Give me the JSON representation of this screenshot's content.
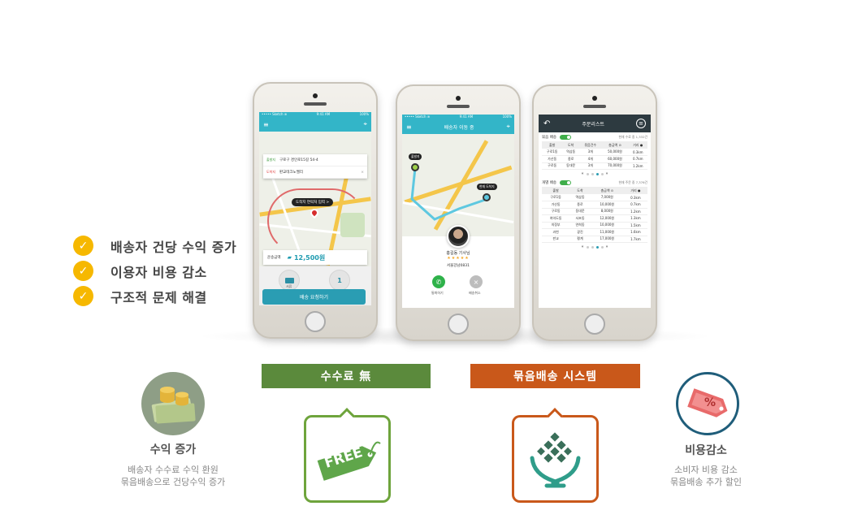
{
  "checklist": [
    "배송자 건당 수익 증가",
    "이용자 비용 감소",
    "구조적 문제 해결"
  ],
  "phone1": {
    "carrier": "••••• Sketch ≋",
    "time": "9:41 AM",
    "battery": "100%",
    "pickup_tag": "출발지",
    "pickup_address": "구로구 경인로15길 54-4",
    "dest_tag": "도착지",
    "dest_address": "판교테크노밸리",
    "bubble": "도착지 연락처 입력 >",
    "fee_label": "운송금액",
    "fee_value": "12,500원",
    "btn1_caption": "서류",
    "btn1_label": "물품종류",
    "btn2_value": "1",
    "btn2_label": "물품갯수",
    "request_button": "배송 요청하기"
  },
  "phone2": {
    "carrier": "••••• Sketch ≋",
    "time": "9:41 AM",
    "battery": "100%",
    "title": "배송자 이동 중",
    "pin_start": "출발지",
    "pin_end": "현재 도착지",
    "driver_name": "홍길동 기사님",
    "driver_stars": "★★★★★",
    "driver_plate": "서울강남0831",
    "call_label": "통화하기",
    "cancel_label": "배송취소"
  },
  "phone3": {
    "title": "주문리스트",
    "bundle_section": "묶음 배송",
    "bundle_note": "현재 수료 중 1,332건",
    "bundle_headers": [
      "출발",
      "도착",
      "묶음건수",
      "총금액 ⊙",
      "거리 ●"
    ],
    "bundle_rows": [
      [
        "구로1동",
        "역삼동",
        "3개",
        "50,000원",
        "0.3km"
      ],
      [
        "가산동",
        "종로",
        "4개",
        "60,000원",
        "0.7km"
      ],
      [
        "구로동",
        "동대문",
        "3개",
        "70,000원",
        "1.2km"
      ]
    ],
    "single_section": "개별 배송",
    "single_note": "현재 주문 중 7,376건",
    "single_headers": [
      "출발",
      "도착",
      "총금액 ⊙",
      "거리 ●"
    ],
    "single_rows": [
      [
        "구로1동",
        "역삼동",
        "7,000원",
        "0.3km"
      ],
      [
        "가산동",
        "종로",
        "10,000원",
        "0.7km"
      ],
      [
        "구로동",
        "동대문",
        "8,000원",
        "1.2km"
      ],
      [
        "여의도동",
        "서초동",
        "12,000원",
        "1.3km"
      ],
      [
        "의정부",
        "연희동",
        "10,000원",
        "1.5km"
      ],
      [
        "과천",
        "광진",
        "11,000원",
        "1.6km"
      ],
      [
        "판교",
        "평계",
        "17,000원",
        "1.7km"
      ]
    ],
    "pager_left": "«",
    "pager_right": "»"
  },
  "features": {
    "income": {
      "title": "수익 증가",
      "desc1": "배송자 수수료 수익 환원",
      "desc2": "묶음배송으로 건당수익 증가"
    },
    "free": {
      "bar": "수수료 無",
      "badge": "FREE"
    },
    "bundle": {
      "bar": "묶음배송 시스템"
    },
    "saving": {
      "title": "비용감소",
      "desc1": "소비자 비용 감소",
      "desc2": "묶음배송 추가 할인",
      "tag_symbol": "%"
    }
  },
  "colors": {
    "check": "#f6b800",
    "teal": "#33b5c8",
    "green_bar": "#5b8a3c",
    "orange_bar": "#c9581a",
    "frame_green": "#6ea43c",
    "frame_orange": "#c9581a"
  }
}
